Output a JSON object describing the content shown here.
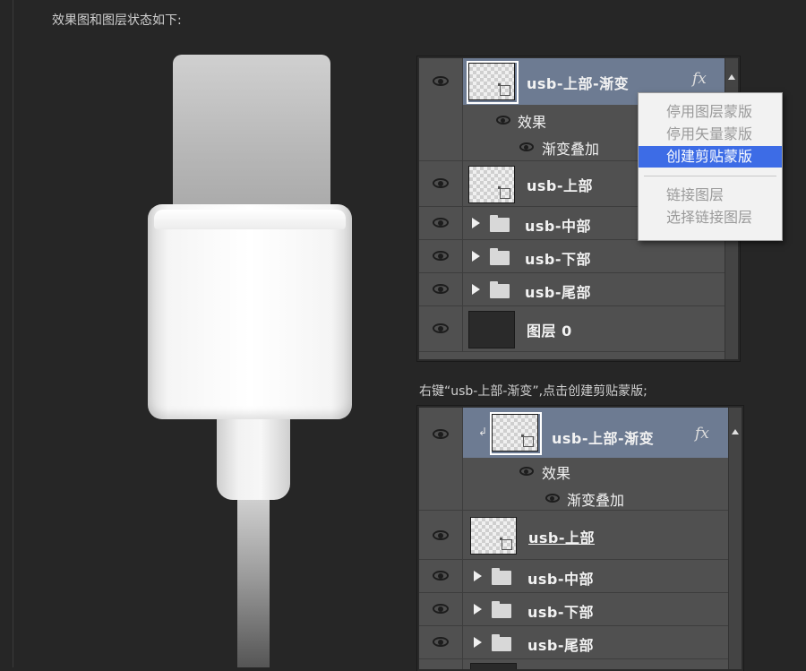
{
  "captions": {
    "top": "效果图和图层状态如下:",
    "middle": "右键“usb-上部-渐变”,点击创建剪贴蒙版;"
  },
  "panel1": {
    "layers": [
      {
        "name": "usb-上部-渐变",
        "fx": "fx",
        "selected": true
      },
      {
        "name": "usb-上部"
      },
      {
        "name": "usb-中部",
        "type": "group"
      },
      {
        "name": "usb-下部",
        "type": "group"
      },
      {
        "name": "usb-尾部",
        "type": "group"
      },
      {
        "name": "图层 0"
      }
    ],
    "effects_label": "效果",
    "effect_item": "渐变叠加"
  },
  "context_menu": {
    "items": [
      "停用图层蒙版",
      "停用矢量蒙版",
      "创建剪贴蒙版",
      "链接图层",
      "选择链接图层"
    ],
    "active_index": 2
  },
  "panel2": {
    "layers": [
      {
        "name": "usb-上部-渐变",
        "fx": "fx",
        "selected": true,
        "clipped": true
      },
      {
        "name": "usb-上部",
        "underlined": true
      },
      {
        "name": "usb-中部",
        "type": "group"
      },
      {
        "name": "usb-下部",
        "type": "group"
      },
      {
        "name": "usb-尾部",
        "type": "group"
      }
    ],
    "effects_label": "效果",
    "effect_item": "渐变叠加"
  },
  "colors": {
    "background": "#262626",
    "panel": "#505050",
    "selected_row": "#6d7b92",
    "menu_highlight": "#3d6ce6"
  },
  "icons": [
    "eye-icon",
    "fx-icon",
    "folder-icon",
    "expand-triangle-icon",
    "clip-arrow-icon",
    "scroll-up-icon"
  ]
}
